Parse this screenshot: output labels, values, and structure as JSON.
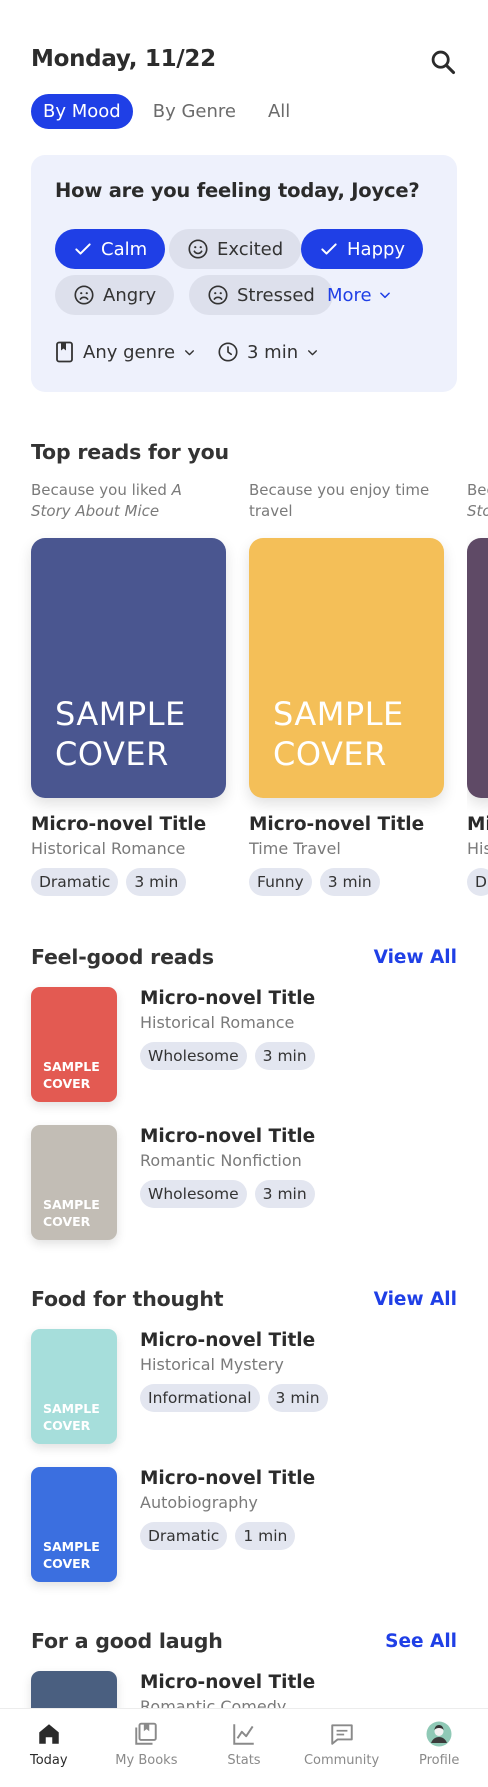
{
  "header": {
    "date": "Monday, 11/22"
  },
  "tabs": [
    {
      "label": "By Mood",
      "active": true
    },
    {
      "label": "By Genre",
      "active": false
    },
    {
      "label": "All",
      "active": false
    }
  ],
  "mood": {
    "question": "How are you feeling today, Joyce?",
    "chips": [
      {
        "label": "Calm",
        "selected": true,
        "icon": "check-icon"
      },
      {
        "label": "Excited",
        "selected": false,
        "icon": "smile-icon"
      },
      {
        "label": "Happy",
        "selected": true,
        "icon": "check-icon"
      },
      {
        "label": "Angry",
        "selected": false,
        "icon": "frown-icon"
      },
      {
        "label": "Stressed",
        "selected": false,
        "icon": "frown-icon"
      }
    ],
    "more_label": "More",
    "genre_filter": "Any genre",
    "time_filter": "3 min"
  },
  "top_reads": {
    "title": "Top reads for you",
    "items": [
      {
        "because_prefix": "Because you liked ",
        "because_em": "A Story About Mice",
        "cover_text": "SAMPLE COVER",
        "cover_color": "#4a5690",
        "title": "Micro-novel Title",
        "genre": "Historical Romance",
        "tags": [
          "Dramatic",
          "3 min"
        ]
      },
      {
        "because_prefix": "Because you enjoy time travel",
        "because_em": "",
        "cover_text": "SAMPLE COVER",
        "cover_color": "#f4bf58",
        "title": "Micro-novel Title",
        "genre": "Time Travel",
        "tags": [
          "Funny",
          "3 min"
        ]
      },
      {
        "because_prefix": "Bec",
        "because_em": "Sto",
        "cover_text": "",
        "cover_color": "#5f4a66",
        "title": "Mi",
        "genre": "His",
        "tags": [
          "D"
        ]
      }
    ]
  },
  "feel_good": {
    "title": "Feel-good reads",
    "link": "View All",
    "items": [
      {
        "cover_text": "SAMPLE COVER",
        "cover_color": "#e35a52",
        "title": "Micro-novel Title",
        "genre": "Historical Romance",
        "tags": [
          "Wholesome",
          "3 min"
        ]
      },
      {
        "cover_text": "SAMPLE COVER",
        "cover_color": "#c2bdb5",
        "title": "Micro-novel Title",
        "genre": "Romantic Nonfiction",
        "tags": [
          "Wholesome",
          "3 min"
        ]
      }
    ]
  },
  "food_thought": {
    "title": "Food for thought",
    "link": "View All",
    "items": [
      {
        "cover_text": "SAMPLE COVER",
        "cover_color": "#a6dedb",
        "title": "Micro-novel Title",
        "genre": "Historical Mystery",
        "tags": [
          "Informational",
          "3 min"
        ]
      },
      {
        "cover_text": "SAMPLE COVER",
        "cover_color": "#3b6fe0",
        "title": "Micro-novel Title",
        "genre": "Autobiography",
        "tags": [
          "Dramatic",
          "1 min"
        ]
      }
    ]
  },
  "good_laugh": {
    "title": "For a good laugh",
    "link": "See All",
    "items": [
      {
        "cover_color": "#4a5f80",
        "title": "Micro-novel Title",
        "genre": "Romantic Comedy"
      }
    ]
  },
  "nav": [
    {
      "label": "Today",
      "icon": "home-icon",
      "active": true
    },
    {
      "label": "My Books",
      "icon": "books-icon",
      "active": false
    },
    {
      "label": "Stats",
      "icon": "chart-icon",
      "active": false
    },
    {
      "label": "Community",
      "icon": "chat-icon",
      "active": false
    },
    {
      "label": "Profile",
      "icon": "avatar-icon",
      "active": false
    }
  ]
}
